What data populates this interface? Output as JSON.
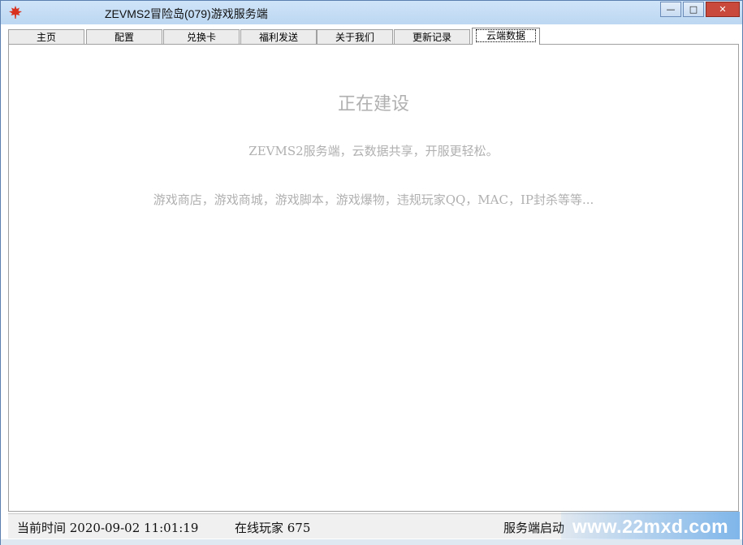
{
  "window": {
    "title": "ZEVMS2冒险岛(079)游戏服务端",
    "controls": {
      "minimize": "—",
      "maximize": "□",
      "close": "✕"
    }
  },
  "tabs": [
    {
      "label": "主页",
      "active": false
    },
    {
      "label": "配置",
      "active": false
    },
    {
      "label": "兑换卡",
      "active": false
    },
    {
      "label": "福利发送",
      "active": false
    },
    {
      "label": "关于我们",
      "active": false
    },
    {
      "label": "更新记录",
      "active": false
    },
    {
      "label": "云端数据",
      "active": true
    }
  ],
  "content": {
    "heading": "正在建设",
    "line1": "ZEVMS2服务端，云数据共享，开服更轻松。",
    "line2": "游戏商店，游戏商城，游戏脚本，游戏爆物，违规玩家QQ，MAC，IP封杀等等..."
  },
  "status": {
    "time": "当前时间 2020-09-02 11:01:19",
    "online": "在线玩家 675",
    "server": "服务端启动"
  },
  "watermark": "www.22mxd.com",
  "colors": {
    "accent": "#c94a3c",
    "muted_text": "#b0b0b0"
  }
}
